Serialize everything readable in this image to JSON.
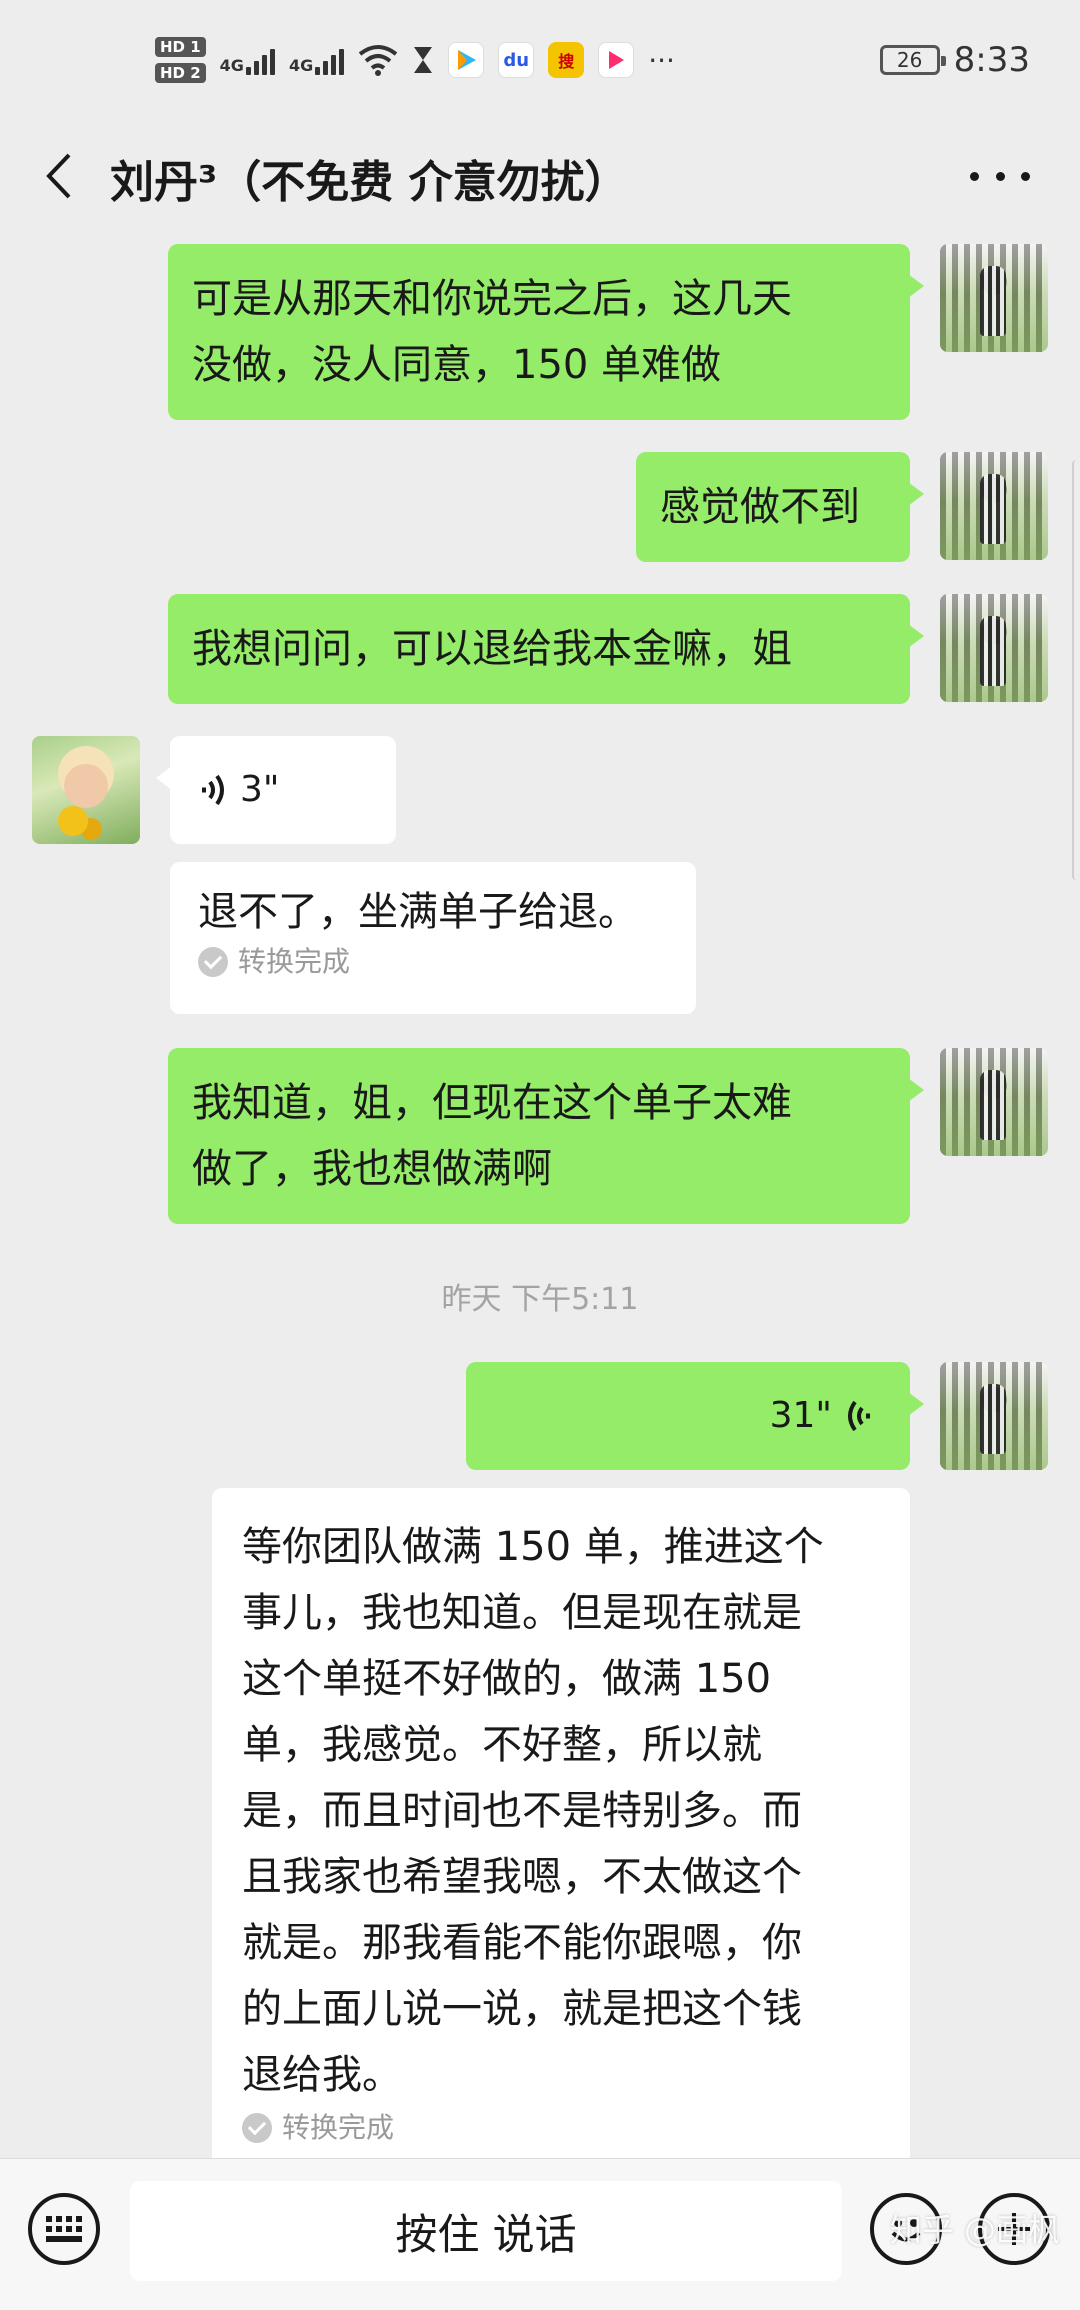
{
  "status_bar": {
    "hd1": "HD 1",
    "hd2": "HD 2",
    "net1": "4G",
    "net2": "4G",
    "more": "···",
    "battery": "26",
    "time": "8:33"
  },
  "header": {
    "title": "刘丹³（不免费 介意勿扰）"
  },
  "messages": {
    "m1": {
      "lines": [
        "可是从那天和你说完之后，这几天",
        "没做，没人同意，150 单难做"
      ]
    },
    "m2": {
      "text": "感觉做不到"
    },
    "m3": {
      "text": "我想问问，可以退给我本金嘛，姐"
    },
    "m4": {
      "duration": "3\""
    },
    "m5": {
      "text": "退不了，坐满单子给退。",
      "status": "转换完成"
    },
    "m6": {
      "lines": [
        "我知道，姐，但现在这个单子太难",
        "做了，我也想做满啊"
      ]
    },
    "timestamp": "昨天 下午5:11",
    "m7": {
      "duration": "31\""
    },
    "m8": {
      "lines": [
        "等你团队做满 150 单，推进这个",
        "事儿，我也知道。但是现在就是",
        "这个单挺不好做的，做满 150",
        "单，我感觉。不好整，所以就",
        "是，而且时间也不是特别多。而",
        "且我家也希望我嗯，不太做这个",
        "就是。那我看能不能你跟嗯，你",
        "的上面儿说一说，就是把这个钱",
        "退给我。"
      ],
      "status": "转换完成"
    }
  },
  "input_bar": {
    "hold_to_talk": "按住 说话"
  },
  "watermark": "知乎 @画枫",
  "colors": {
    "sent_bubble": "#95ec69",
    "received_bubble": "#ffffff",
    "background": "#ededed"
  }
}
